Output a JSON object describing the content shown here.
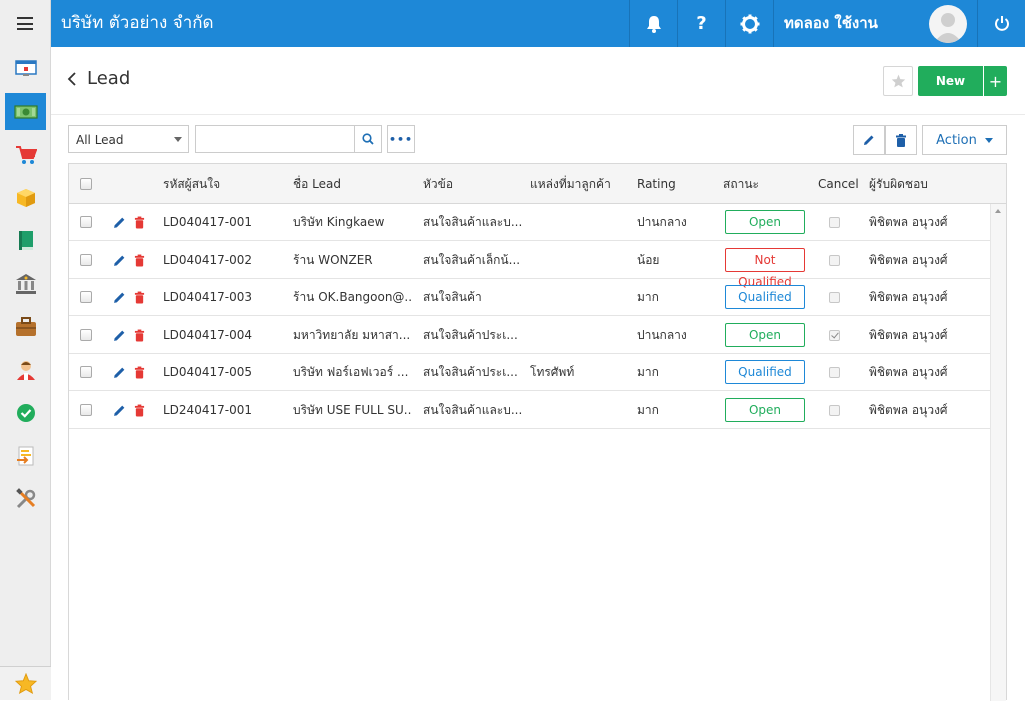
{
  "colors": {
    "primary": "#1e88d7",
    "success": "#21ad5c",
    "danger": "#e53935",
    "qualified": "#1e88d7"
  },
  "topbar": {
    "company": "บริษัท ตัวอย่าง จำกัด",
    "username": "ทดลอง ใช้งาน"
  },
  "sidebar": {
    "items": [
      {
        "name": "dashboard-icon"
      },
      {
        "name": "money-icon",
        "active": true
      },
      {
        "name": "cart-icon"
      },
      {
        "name": "box-icon"
      },
      {
        "name": "book-icon"
      },
      {
        "name": "bank-icon"
      },
      {
        "name": "briefcase-icon"
      },
      {
        "name": "people-icon"
      },
      {
        "name": "check-circle-icon"
      },
      {
        "name": "transfer-icon"
      },
      {
        "name": "tools-icon"
      }
    ]
  },
  "page": {
    "title": "Lead",
    "new_label": "New",
    "plus_label": "+"
  },
  "toolbar": {
    "filter_value": "All Lead",
    "search_value": "",
    "more_label": "•••",
    "action_label": "Action"
  },
  "table": {
    "headers": {
      "code": "รหัสผู้สนใจ",
      "name": "ชื่อ Lead",
      "topic": "หัวข้อ",
      "source": "แหล่งที่มาลูกค้า",
      "rating": "Rating",
      "status": "สถานะ",
      "cancel": "Cancel",
      "owner": "ผู้รับผิดชอบ"
    },
    "rows": [
      {
        "code": "LD040417-001",
        "name": "บริษัท Kingkaew",
        "topic": "สนใจสินค้าและบ...",
        "source": "",
        "rating": "ปานกลาง",
        "status": "Open",
        "status_type": "open",
        "cancelled": false,
        "owner": "พิชิตพล อนุวงศ์"
      },
      {
        "code": "LD040417-002",
        "name": "ร้าน WONZER",
        "topic": "สนใจสินค้าเล็กน้...",
        "source": "",
        "rating": "น้อย",
        "status": "Not Qualified",
        "status_type": "notq",
        "cancelled": false,
        "owner": "พิชิตพล อนุวงศ์"
      },
      {
        "code": "LD040417-003",
        "name": "ร้าน OK.Bangoon@...",
        "topic": "สนใจสินค้า",
        "source": "",
        "rating": "มาก",
        "status": "Qualified",
        "status_type": "qualified",
        "cancelled": false,
        "owner": "พิชิตพล อนุวงศ์"
      },
      {
        "code": "LD040417-004",
        "name": "มหาวิทยาลัย มหาสา...",
        "topic": "สนใจสินค้าประเ...",
        "source": "",
        "rating": "ปานกลาง",
        "status": "Open",
        "status_type": "open",
        "cancelled": true,
        "owner": "พิชิตพล อนุวงศ์"
      },
      {
        "code": "LD040417-005",
        "name": "บริษัท ฟอร์เอฟเวอร์ ...",
        "topic": "สนใจสินค้าประเ...",
        "source": "โทรศัพท์",
        "rating": "มาก",
        "status": "Qualified",
        "status_type": "qualified",
        "cancelled": false,
        "owner": "พิชิตพล อนุวงศ์"
      },
      {
        "code": "LD240417-001",
        "name": "บริษัท USE FULL SU...",
        "topic": "สนใจสินค้าและบ...",
        "source": "",
        "rating": "มาก",
        "status": "Open",
        "status_type": "open",
        "cancelled": false,
        "owner": "พิชิตพล อนุวงศ์"
      }
    ]
  }
}
